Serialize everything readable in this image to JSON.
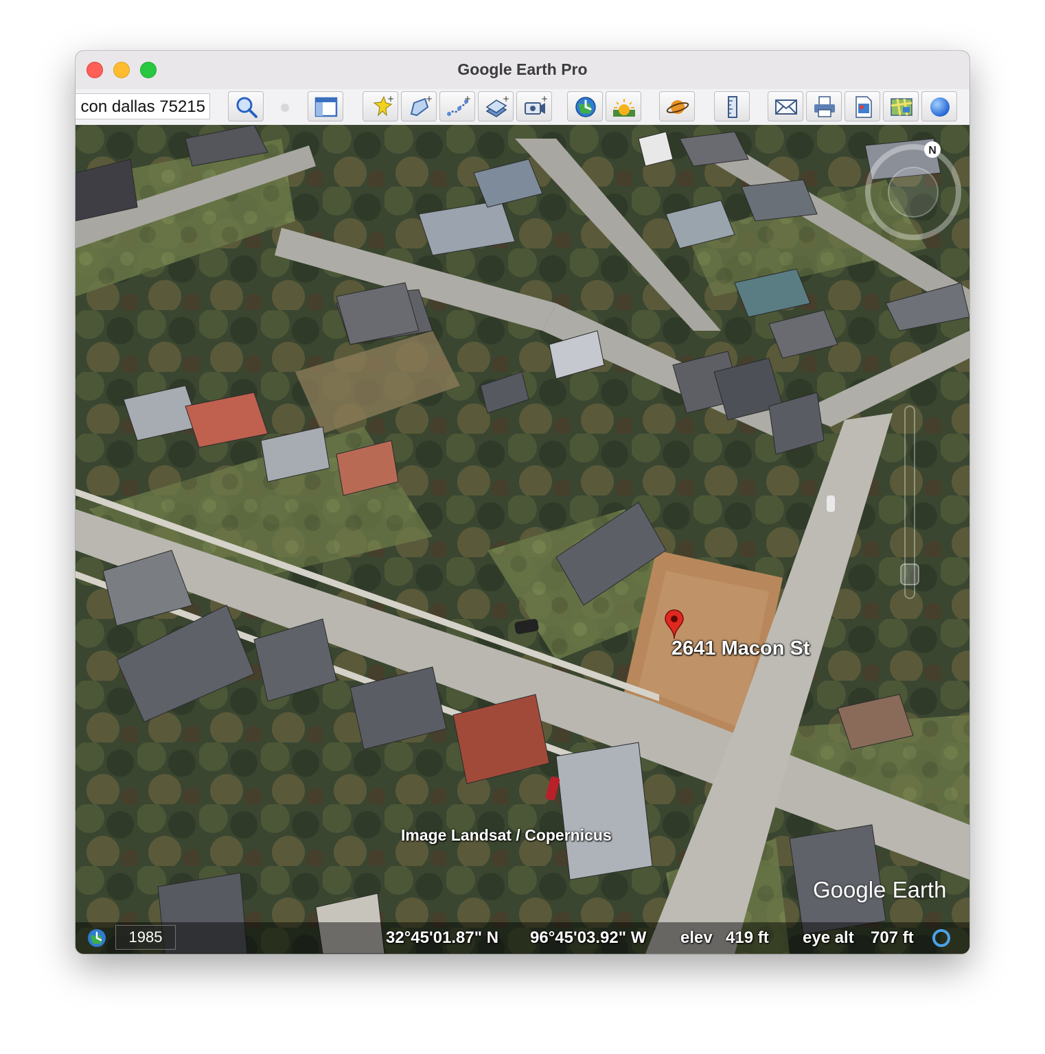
{
  "window": {
    "title": "Google Earth Pro"
  },
  "toolbar": {
    "search_value": "con dallas 75215",
    "buttons": [
      {
        "name": "search-icon"
      },
      {
        "name": "sidebar-toggle-icon"
      },
      {
        "name": "add-placemark-icon"
      },
      {
        "name": "add-polygon-icon"
      },
      {
        "name": "add-path-icon"
      },
      {
        "name": "image-overlay-icon"
      },
      {
        "name": "record-tour-icon"
      },
      {
        "name": "historical-imagery-icon"
      },
      {
        "name": "sunlight-icon"
      },
      {
        "name": "planets-icon"
      },
      {
        "name": "ruler-icon"
      },
      {
        "name": "email-icon"
      },
      {
        "name": "print-icon"
      },
      {
        "name": "save-image-icon"
      },
      {
        "name": "view-in-maps-icon"
      },
      {
        "name": "earth-icon"
      }
    ]
  },
  "map": {
    "placemark_label": "2641 Macon St",
    "attribution": "Image Landsat / Copernicus",
    "brand": "Google Earth",
    "compass_letter": "N"
  },
  "status": {
    "year": "1985",
    "latitude": "32°45'01.87\" N",
    "longitude": "96°45'03.92\" W",
    "elev_label": "elev",
    "elev_value": "419 ft",
    "eye_alt_label": "eye alt",
    "eye_alt_value": "707 ft"
  },
  "colors": {
    "accent": "#2f6fde",
    "pin": "#e0281f"
  }
}
